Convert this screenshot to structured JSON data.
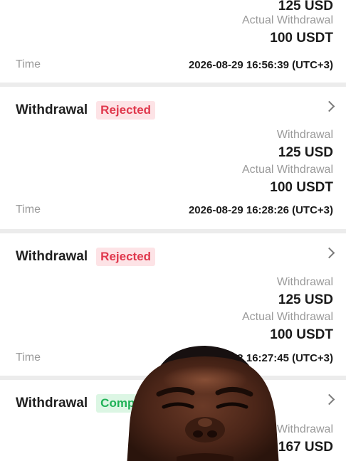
{
  "records": [
    {
      "type": "",
      "status": "",
      "withdrawal_label": "",
      "withdrawal_amount": "125 USD",
      "actual_label": "Actual Withdrawal",
      "actual_amount": "100 USDT",
      "time_label": "Time",
      "time_value": "2026-08-29 16:56:39 (UTC+3)"
    },
    {
      "type": "Withdrawal",
      "status": "Rejected",
      "withdrawal_label": "Withdrawal",
      "withdrawal_amount": "125 USD",
      "actual_label": "Actual Withdrawal",
      "actual_amount": "100 USDT",
      "time_label": "Time",
      "time_value": "2026-08-29 16:28:26 (UTC+3)"
    },
    {
      "type": "Withdrawal",
      "status": "Rejected",
      "withdrawal_label": "Withdrawal",
      "withdrawal_amount": "125 USD",
      "actual_label": "Actual Withdrawal",
      "actual_amount": "100 USDT",
      "time_label": "Time",
      "time_value": "? 16:27:45 (UTC+3)"
    },
    {
      "type": "Withdrawal",
      "status": "Comple",
      "withdrawal_label": "Withdrawal",
      "withdrawal_amount": "167 USD"
    }
  ],
  "colors": {
    "rejected_bg": "#fde3e6",
    "rejected_text": "#e0384d",
    "completed_bg": "#dcf6e4",
    "completed_text": "#1fb257"
  },
  "overlay": {
    "icon": "face-photo-overlay"
  }
}
